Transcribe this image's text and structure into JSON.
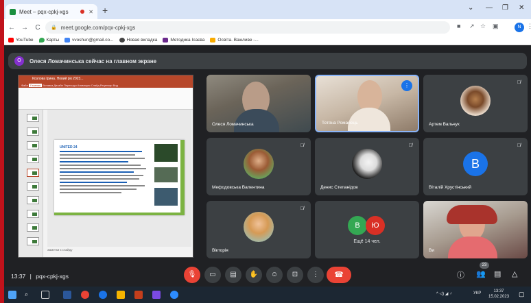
{
  "browser": {
    "tab_title": "Meet – pqx-cpkj-xgs",
    "new_tab_symbol": "+",
    "url": "meet.google.com/pqx-cpkj-xgs",
    "profile_initial": "N",
    "bookmarks": [
      "YouTube",
      "Карты",
      "vvoshun@gmail.co...",
      "Новая вкладка",
      "Методика Ісаєва",
      "Освіта. Важливе -..."
    ]
  },
  "meet": {
    "banner_initial": "О",
    "banner_text": "Олеся Ломачинська сейчас на главном экране",
    "participants": [
      {
        "name": "Олеся Ломачинська",
        "muted": false
      },
      {
        "name": "Тетяна Романець",
        "muted": false,
        "speaking": true
      },
      {
        "name": "Артем Вальчук",
        "muted": true
      },
      {
        "name": "Мефодовська Валентина",
        "muted": true
      },
      {
        "name": "Денис Степанідов",
        "muted": true
      },
      {
        "name": "Віталій Хрустінський",
        "muted": true,
        "initial": "В"
      },
      {
        "name": "Вікторія",
        "muted": true
      },
      {
        "name": "Ви",
        "muted": false
      }
    ],
    "more_tile": {
      "initials": [
        "В",
        "Ю"
      ],
      "label": "Ещё 14 чел."
    },
    "time": "13:37",
    "meeting_code": "pqx-cpkj-xgs",
    "separator": "|",
    "participants_count": "23"
  },
  "powerpoint": {
    "title": "Козлова Ірина. Новий рік 2023...",
    "tabs": [
      "Файл",
      "Главная",
      "Вставка",
      "Дизайн",
      "Переходы",
      "Анимация",
      "Слайд",
      "Рецензир",
      "Вид"
    ],
    "notes_placeholder": "Заметки к слайду",
    "slide_title": "UNITED 24"
  },
  "taskbar": {
    "lang": "УКР",
    "clock_time": "13:37",
    "clock_date": "15.02.2023"
  },
  "colors": {
    "meet_bg": "#202124",
    "tile_bg": "#3c4043",
    "accent_blue": "#1a73e8",
    "end_call_red": "#ea4335",
    "ppt_orange": "#b7472a"
  }
}
